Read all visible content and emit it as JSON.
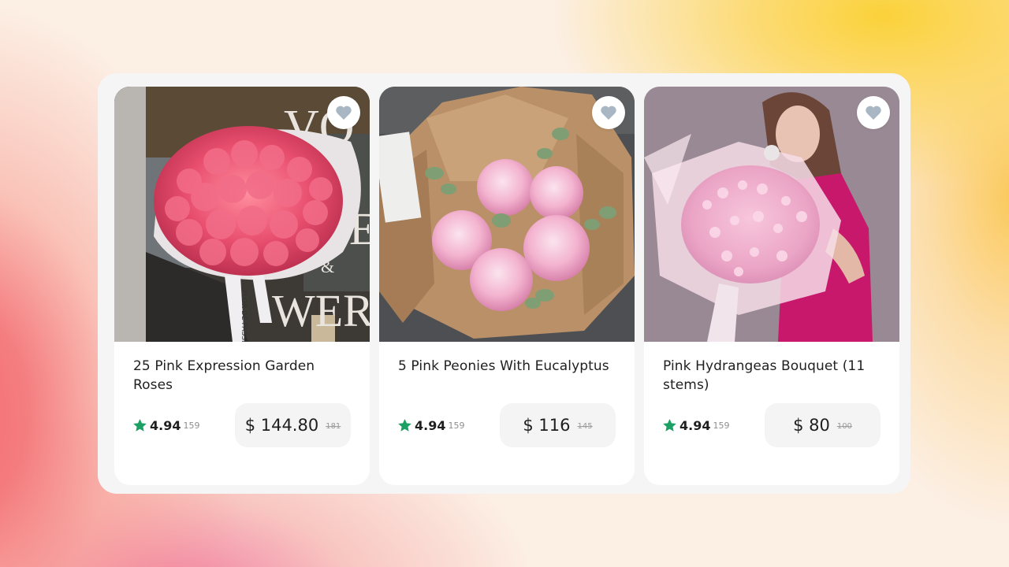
{
  "products": [
    {
      "title": "25 Pink Expression Garden Roses",
      "rating": "4.94",
      "reviews": "159",
      "price": "$ 144.80",
      "old_price": "181",
      "photo_text": {
        "line1": "VO",
        "line2": "E",
        "line3": "&",
        "line4": "WER",
        "ribbon": "FLOR DE PASSION"
      }
    },
    {
      "title": "5 Pink Peonies With Eucalyptus",
      "rating": "4.94",
      "reviews": "159",
      "price": "$ 116",
      "old_price": "145"
    },
    {
      "title": "Pink Hydrangeas Bouquet (11 stems)",
      "rating": "4.94",
      "reviews": "159",
      "price": "$ 80",
      "old_price": "100"
    }
  ],
  "icons": {
    "favorite": "heart-icon",
    "rating": "star-icon"
  },
  "colors": {
    "star": "#1aa163",
    "heart": "#a9b7c4",
    "price_bg": "#f4f4f4"
  }
}
